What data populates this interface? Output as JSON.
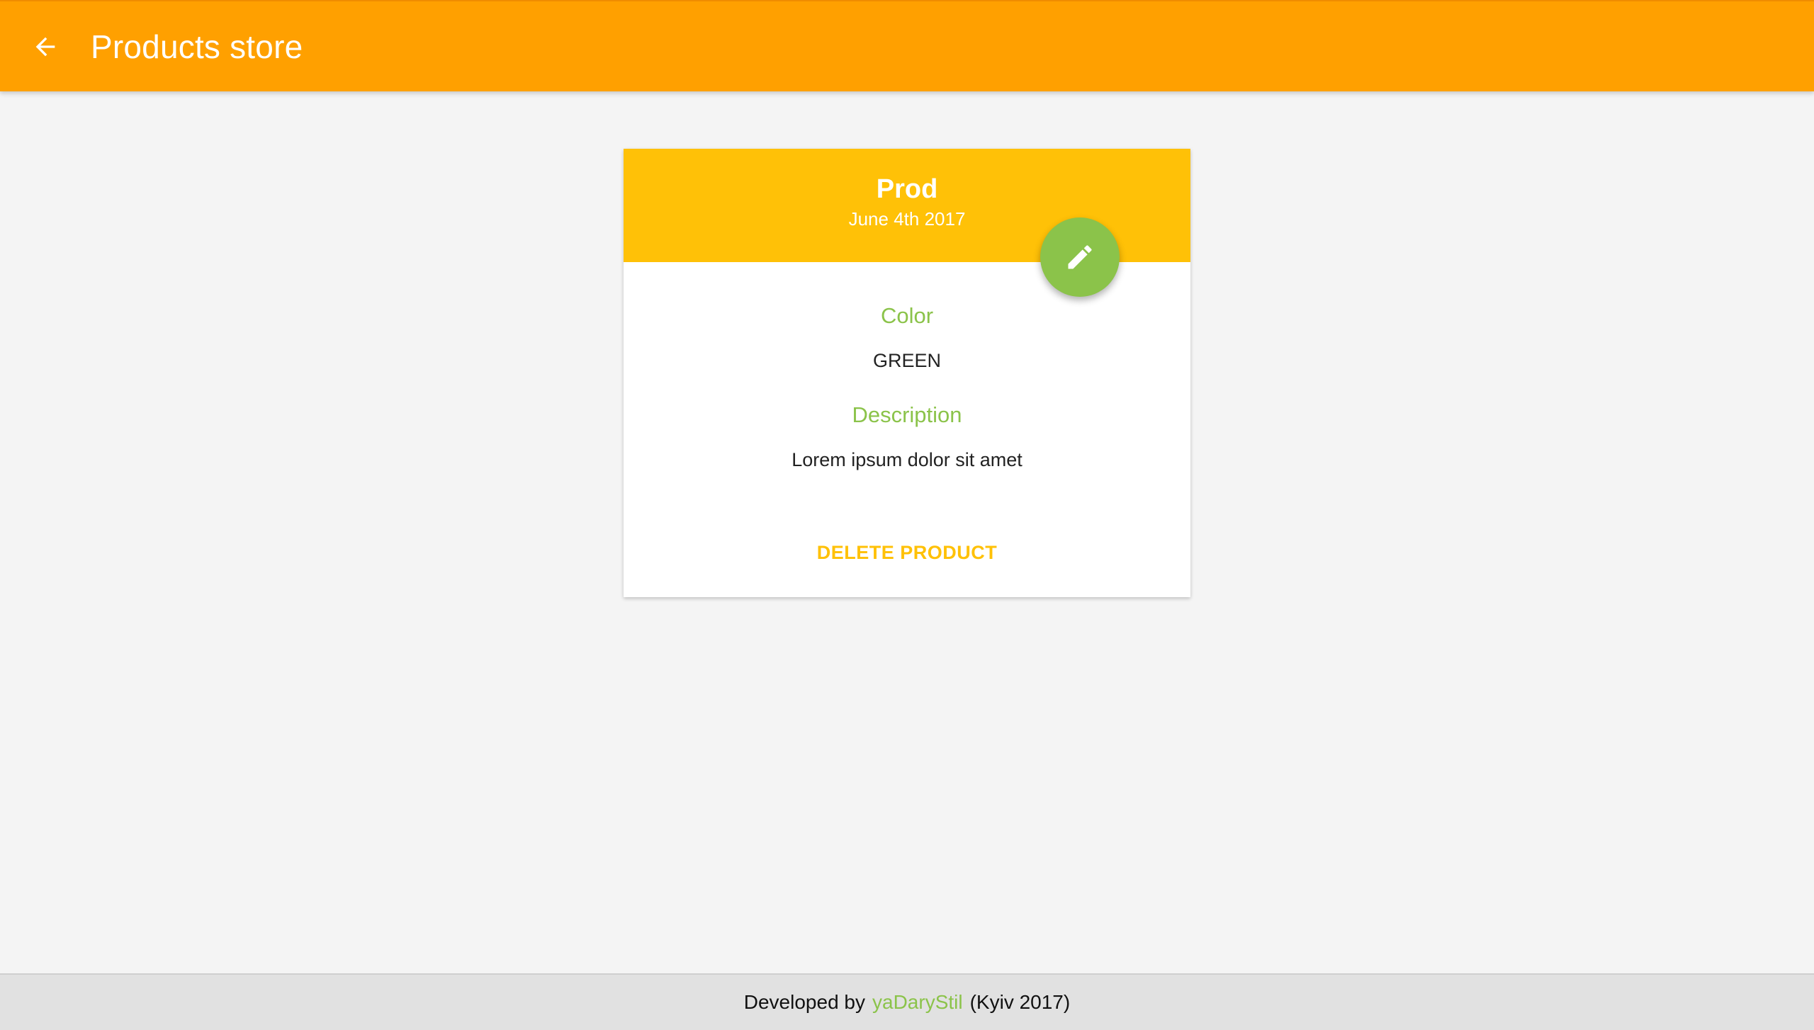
{
  "appbar": {
    "title": "Products store",
    "back_icon": "arrow-back-icon",
    "color": "#ffa000"
  },
  "product": {
    "name": "Prod",
    "date": "June 4th 2017",
    "header_color": "#ffc107",
    "edit_icon": "pencil-icon",
    "fab_color": "#8bc34a",
    "fields": {
      "color_label": "Color",
      "color_value": "GREEN",
      "description_label": "Description",
      "description_value": "Lorem ipsum dolor sit amet"
    },
    "delete_label": "DELETE PRODUCT"
  },
  "footer": {
    "prefix": "Developed by",
    "link": "yaDaryStil",
    "suffix": "(Kyiv 2017)",
    "link_color": "#8bc34a"
  }
}
